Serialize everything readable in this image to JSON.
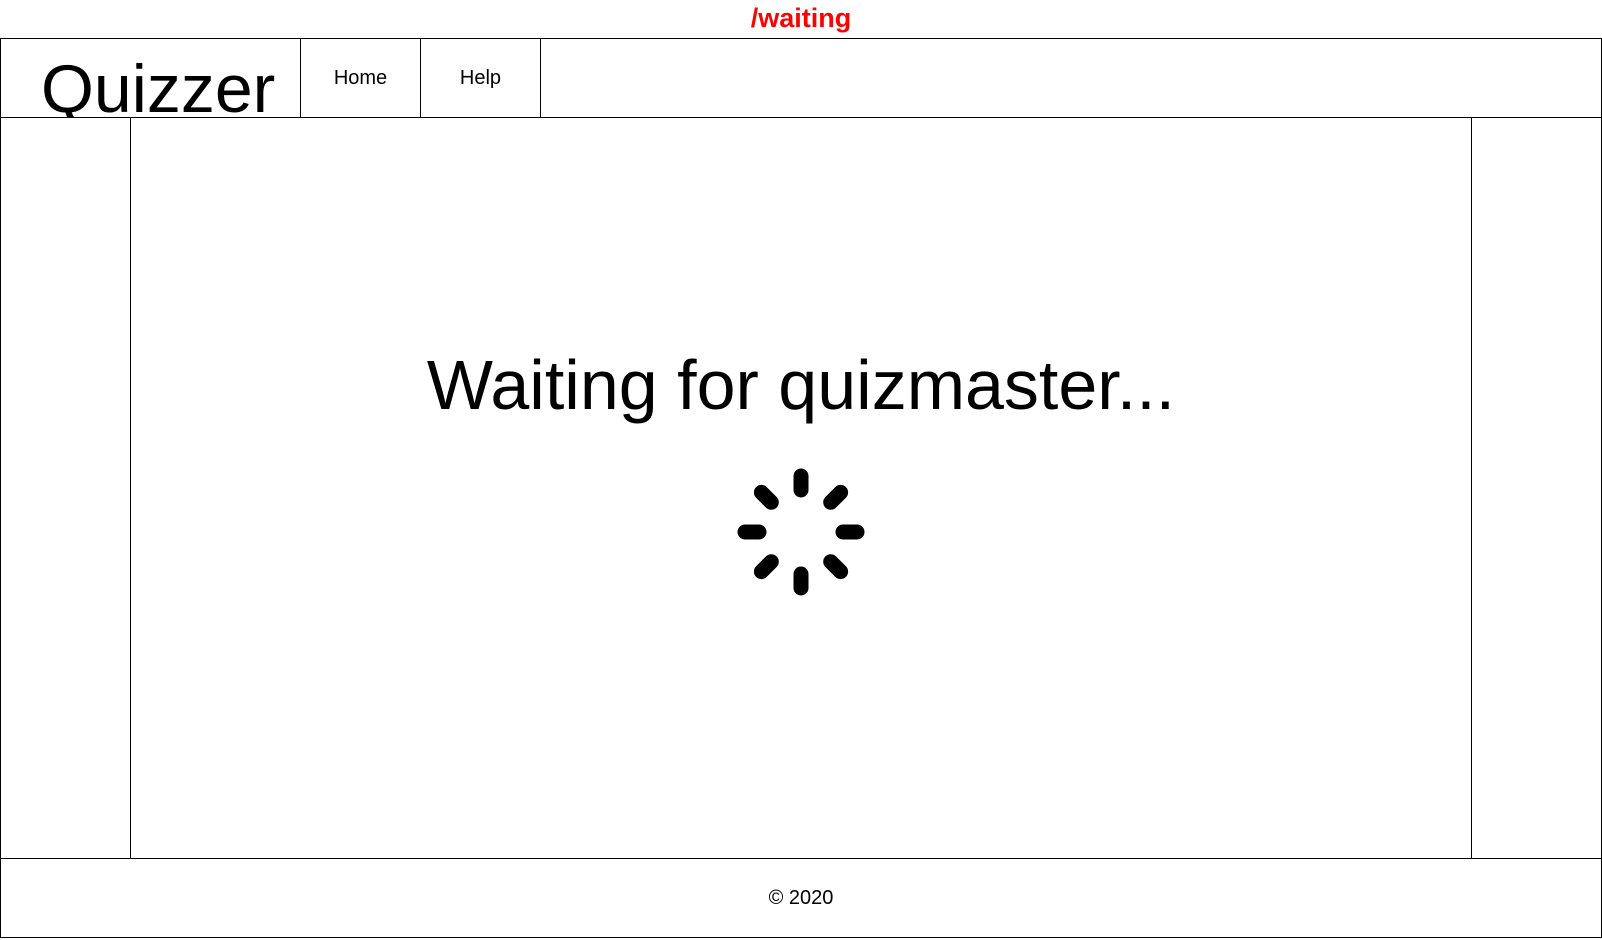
{
  "route": {
    "label": "/waiting",
    "color": "#ff0000"
  },
  "header": {
    "logo": "Quizzer",
    "nav": [
      {
        "label": "Home"
      },
      {
        "label": "Help"
      }
    ]
  },
  "main": {
    "status_text": "Waiting for quizmaster...",
    "spinner_icon": "loading-spinner-icon"
  },
  "footer": {
    "copyright": "© 2020"
  },
  "colors": {
    "text": "#000000",
    "border": "#000000",
    "background": "#ffffff",
    "route_label": "#ff0000"
  }
}
